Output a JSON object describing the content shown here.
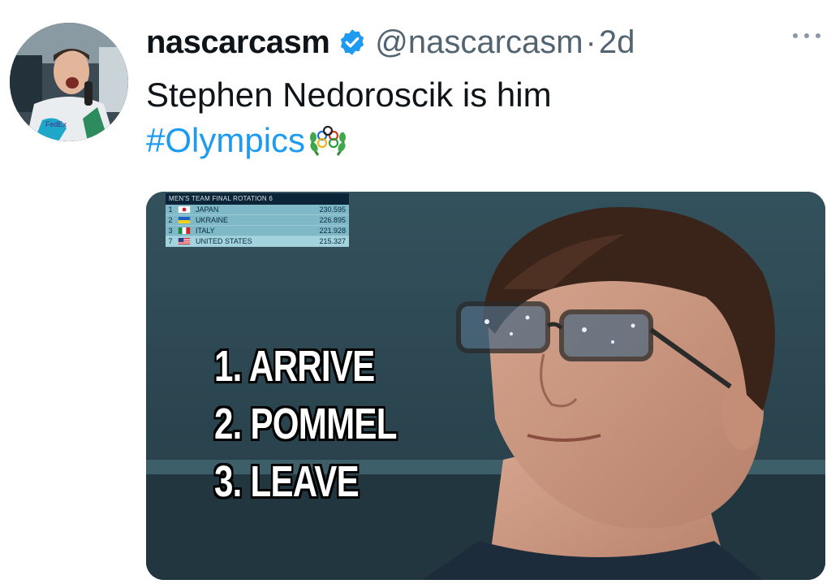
{
  "tweet": {
    "display_name": "nascarcasm",
    "handle": "@nascarcasm",
    "separator": "·",
    "time": "2d",
    "text": "Stephen Nedoroscik is him",
    "hashtag": "#Olympics",
    "verified": true,
    "avatar_icon": "avatar-driver-photo",
    "more_icon": "more-icon",
    "emoji_icon": "olympic-rings-laurel-icon"
  },
  "media": {
    "scoreboard": {
      "title": "MEN'S TEAM FINAL  ROTATION 6",
      "rows": [
        {
          "pos": "1",
          "country": "JAPAN",
          "score": "230.595",
          "flag": "japan-flag-icon"
        },
        {
          "pos": "2",
          "country": "UKRAINE",
          "score": "226.895",
          "flag": "ukraine-flag-icon"
        },
        {
          "pos": "3",
          "country": "ITALY",
          "score": "221.928",
          "flag": "italy-flag-icon"
        },
        {
          "pos": "7",
          "country": "UNITED STATES",
          "score": "215.327",
          "flag": "usa-flag-icon"
        }
      ]
    },
    "steps": [
      "1. ARRIVE",
      "2. POMMEL",
      "3. LEAVE"
    ]
  },
  "colors": {
    "link": "#1d9bf0",
    "text": "#0f1419",
    "muted": "#536471"
  }
}
